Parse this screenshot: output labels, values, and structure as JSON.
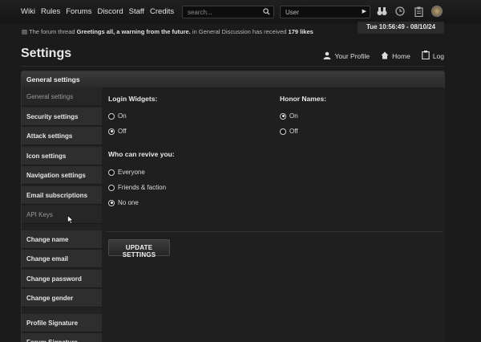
{
  "topnav": [
    "Wiki",
    "Rules",
    "Forums",
    "Discord",
    "Staff",
    "Credits"
  ],
  "search": {
    "placeholder": "search..."
  },
  "user_select": {
    "value": "User"
  },
  "top_icons": [
    "binoculars-icon",
    "clock-icon",
    "clipboard-icon",
    "avatar"
  ],
  "notice": {
    "prefix": "The forum thread",
    "thread": "Greetings all, a warning from the future.",
    "middle": "in General Discussion has received",
    "likes": "179 likes"
  },
  "clock": "Tue 10:56:49 - 08/10/24",
  "page_title": "Settings",
  "header_links": [
    {
      "label": "Your Profile",
      "icon": "person-icon"
    },
    {
      "label": "Home",
      "icon": "home-icon"
    },
    {
      "label": "Log",
      "icon": "log-icon"
    }
  ],
  "panel_title": "General settings",
  "sidebar": {
    "group1": [
      "General settings",
      "Security settings",
      "Attack settings",
      "Icon settings",
      "Navigation settings",
      "Email subscriptions",
      "API Keys"
    ],
    "group2": [
      "Change name",
      "Change email",
      "Change password",
      "Change gender"
    ],
    "group3": [
      "Profile Signature",
      "Forum Signature"
    ]
  },
  "settings": {
    "login_widgets": {
      "label": "Login Widgets:",
      "options": [
        "On",
        "Off"
      ],
      "selected": "Off"
    },
    "honor_names": {
      "label": "Honor Names:",
      "options": [
        "On",
        "Off"
      ],
      "selected": "On"
    },
    "revive": {
      "label": "Who can revive you:",
      "options": [
        "Everyone",
        "Friends & faction",
        "No one"
      ],
      "selected": "No one"
    }
  },
  "update_button": "UPDATE SETTINGS"
}
